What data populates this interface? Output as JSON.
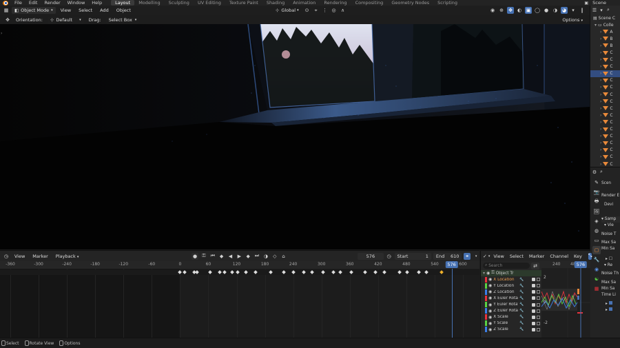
{
  "menubar": {
    "items": [
      "File",
      "Edit",
      "Render",
      "Window",
      "Help"
    ],
    "workspaces": [
      "Layout",
      "Modelling",
      "Sculpting",
      "UV Editing",
      "Texture Paint",
      "Shading",
      "Animation",
      "Rendering",
      "Compositing",
      "Geometry Nodes",
      "Scripting"
    ],
    "active_workspace": "Layout",
    "scene": "Scene"
  },
  "viewport": {
    "mode": "Object Mode",
    "menus": [
      "View",
      "Select",
      "Add",
      "Object"
    ],
    "transform_orientation": "Global",
    "orientation_label": "Orientation:",
    "orientation_value": "Default",
    "drag_label": "Drag:",
    "drag_value": "Select Box",
    "options_label": "Options"
  },
  "outliner": {
    "title": "Scene C",
    "collection": "Colle",
    "row_letters": [
      "A",
      "B",
      "B",
      "C",
      "C",
      "C",
      "C",
      "C",
      "C",
      "C",
      "C",
      "C",
      "C",
      "C",
      "C",
      "C",
      "C",
      "C",
      "C",
      "C"
    ],
    "selected_index": 6
  },
  "properties": {
    "scene_label": "Scen",
    "render_engine_label": "Render E",
    "device_label": "Devi",
    "sampling_label": "Samp",
    "viewport_label": "Vie",
    "noise_threshold": "Noise T",
    "max_samples": "Max Sa",
    "min_samples": "Min Sa",
    "render_label": "Re",
    "noise_threshold2": "Noise Th",
    "max_samples2": "Max Sa",
    "min_samples2": "Min Sa",
    "time_limit": "Time Li"
  },
  "timeline": {
    "menus": [
      "View",
      "Marker",
      "Playback"
    ],
    "current_frame": "576",
    "start_label": "Start",
    "start_value": "1",
    "end_label": "End",
    "end_value": "610",
    "ruler": [
      -360,
      -300,
      -240,
      -180,
      -120,
      -60,
      0,
      60,
      120,
      180,
      240,
      300,
      360,
      420,
      480,
      540,
      600
    ],
    "playhead": 576,
    "keyframes": [
      0,
      10,
      30,
      36,
      64,
      84,
      94,
      110,
      122,
      140,
      160,
      192,
      220,
      240,
      262,
      280,
      304,
      326,
      340,
      364,
      392,
      414,
      434,
      466,
      482,
      506,
      522,
      554
    ]
  },
  "graph_editor": {
    "menus": [
      "View",
      "Select",
      "Marker",
      "Channel",
      "Key"
    ],
    "search_placeholder": "Search",
    "ruler": [
      240,
      480
    ],
    "current_frame": "576",
    "y_labels": [
      "2",
      "0",
      "-2"
    ],
    "object_label": "Object Tr",
    "channels": [
      {
        "name": "X Location",
        "color": "#e8323c",
        "highlight": true
      },
      {
        "name": "Y Location",
        "color": "#5ad243",
        "highlight": false
      },
      {
        "name": "Z Location",
        "color": "#3c7ee8",
        "highlight": false
      },
      {
        "name": "X Euler Rotat",
        "color": "#e8323c",
        "highlight": false
      },
      {
        "name": "Y Euler Rotat",
        "color": "#5ad243",
        "highlight": false
      },
      {
        "name": "Z Euler Rotat",
        "color": "#3c7ee8",
        "highlight": false
      },
      {
        "name": "X Scale",
        "color": "#e8323c",
        "highlight": false
      },
      {
        "name": "Y Scale",
        "color": "#5ad243",
        "highlight": false
      },
      {
        "name": "Z Scale",
        "color": "#3c7ee8",
        "highlight": false
      }
    ]
  },
  "statusbar": {
    "items": [
      "Select",
      "Rotate View",
      "Options"
    ]
  },
  "colors": {
    "accent": "#4772b3",
    "keyframe_selected": "#f0b12a",
    "outliner_object": "#e8893a"
  }
}
